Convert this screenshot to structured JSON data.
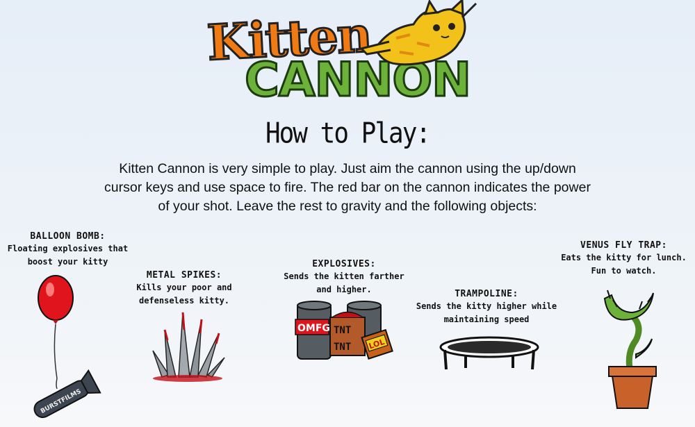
{
  "logo": {
    "line1": "Kitten",
    "line2": "CANNON"
  },
  "heading": "How to Play:",
  "intro": "Kitten Cannon is very simple to play. Just aim the cannon using the up/down cursor keys and use space to fire. The red bar on the cannon indicates the power of your shot. Leave the rest to gravity and the following objects:",
  "items": [
    {
      "title": "BALLOON BOMB:",
      "desc": "Floating explosives that boost your kitty",
      "bomb_label": "BURSTFILMS"
    },
    {
      "title": "METAL SPIKES:",
      "desc": "Kills your poor and defenseless kitty."
    },
    {
      "title": "EXPLOSIVES:",
      "desc": "Sends the kitten farther and higher.",
      "labels": [
        "OMFG",
        "TNT",
        "TNT",
        "LOL"
      ]
    },
    {
      "title": "TRAMPOLINE:",
      "desc": "Sends the kitty higher while maintaining speed"
    },
    {
      "title": "VENUS FLY TRAP:",
      "desc": "Eats the kitty for lunch. Fun to watch."
    }
  ],
  "colors": {
    "balloon": "#e0141c",
    "cannon_green": "#6cb23a",
    "kitten_orange": "#f07a14",
    "pot": "#c8612a",
    "plant": "#4f8a24"
  }
}
